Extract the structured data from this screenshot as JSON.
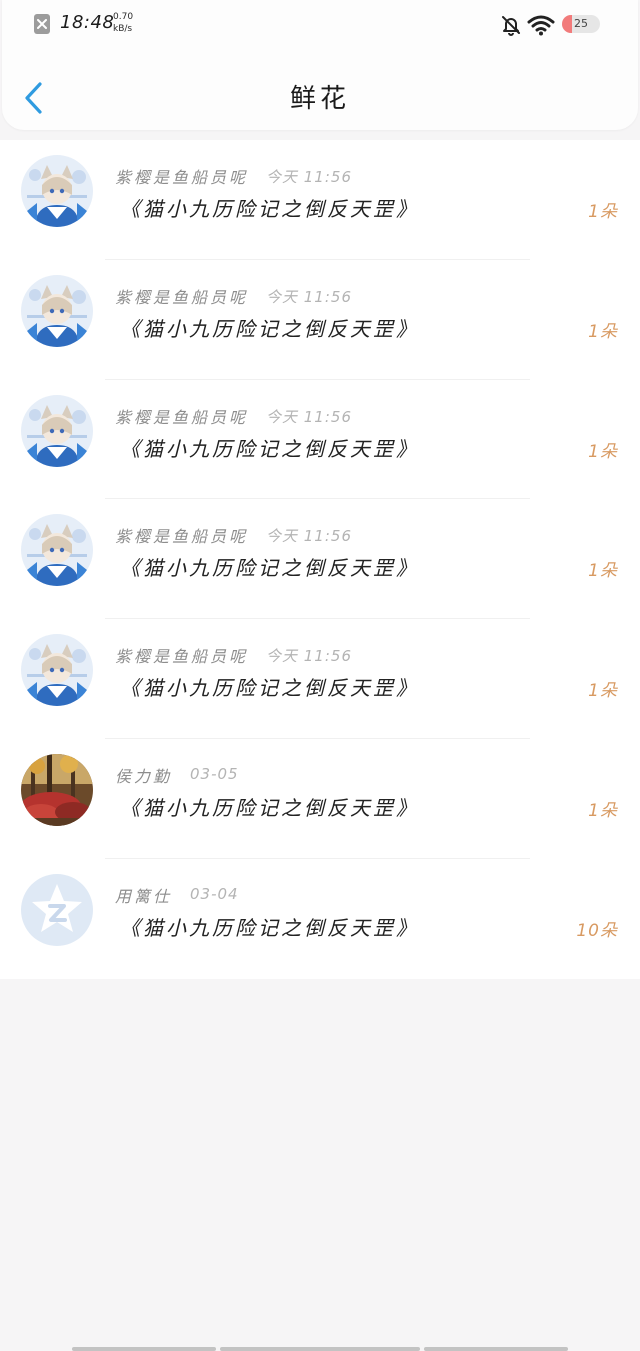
{
  "status_bar": {
    "time": "18:48",
    "net_speed_value": "0.70",
    "net_speed_unit": "kB/s",
    "battery": "25",
    "battery_level": 0.25,
    "icons": [
      "notification-icon",
      "mute-bell-icon",
      "wifi-icon",
      "battery-icon"
    ]
  },
  "header": {
    "title": "鲜花",
    "back_icon": "chevron-left-icon"
  },
  "colors": {
    "accent": "#2f9be0",
    "count": "#d89a62",
    "name": "#8d8d8d",
    "timestamp": "#b4b4b4"
  },
  "rows": [
    {
      "name": "紫樱是鱼船员呢",
      "time": "今天 11:56",
      "book": "《猫小九历险记之倒反天罡》",
      "count": "1朵",
      "avatar": "anime-avatar"
    },
    {
      "name": "紫樱是鱼船员呢",
      "time": "今天 11:56",
      "book": "《猫小九历险记之倒反天罡》",
      "count": "1朵",
      "avatar": "anime-avatar"
    },
    {
      "name": "紫樱是鱼船员呢",
      "time": "今天 11:56",
      "book": "《猫小九历险记之倒反天罡》",
      "count": "1朵",
      "avatar": "anime-avatar"
    },
    {
      "name": "紫樱是鱼船员呢",
      "time": "今天 11:56",
      "book": "《猫小九历险记之倒反天罡》",
      "count": "1朵",
      "avatar": "anime-avatar"
    },
    {
      "name": "紫樱是鱼船员呢",
      "time": "今天 11:56",
      "book": "《猫小九历险记之倒反天罡》",
      "count": "1朵",
      "avatar": "anime-avatar"
    },
    {
      "name": "侯力勤",
      "time": "03-05",
      "book": "《猫小九历险记之倒反天罡》",
      "count": "1朵",
      "avatar": "autumn-photo-avatar"
    },
    {
      "name": "用篱仕",
      "time": "03-04",
      "book": "《猫小九历险记之倒反天罡》",
      "count": "10朵",
      "avatar": "default-star-avatar"
    }
  ]
}
